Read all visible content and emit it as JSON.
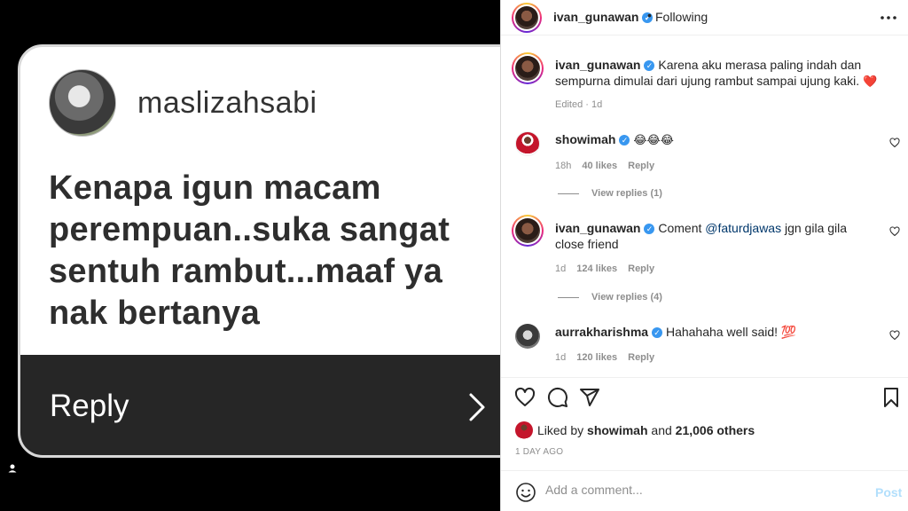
{
  "media": {
    "card_username": "maslizahsabi",
    "card_question": "Kenapa igun macam perempuan..suka sangat sentuh rambut...maaf ya nak bertanya",
    "reply_label": "Reply",
    "icons": [
      "chevron-right-icon",
      "tagged-user-icon"
    ]
  },
  "header": {
    "username": "ivan_gunawan",
    "separator": "•",
    "follow_status": "Following",
    "verified_mark": "✓"
  },
  "caption": {
    "username": "ivan_gunawan",
    "text": "Karena aku merasa paling indah dan sempurna dimulai dari ujung rambut sampai ujung kaki.",
    "emoji": "❤️",
    "meta": "Edited · 1d"
  },
  "comments": [
    {
      "username": "showimah",
      "text": "😂😂😂",
      "time": "18h",
      "likes": "40 likes",
      "reply_label": "Reply",
      "view_replies": "View replies (1)"
    },
    {
      "username": "ivan_gunawan",
      "text_prefix": "Coment ",
      "mention": "@faturdjawas",
      "text_suffix": " jgn gila gila close friend",
      "time": "1d",
      "likes": "124 likes",
      "reply_label": "Reply",
      "view_replies": "View replies (4)"
    },
    {
      "username": "aurrakharishma",
      "text": "Hahahaha well said! 💯",
      "time": "1d",
      "likes": "120 likes",
      "reply_label": "Reply"
    }
  ],
  "liked_by": {
    "prefix": "Liked by ",
    "user": "showimah",
    "middle": " and ",
    "others": "21,006 others"
  },
  "post_date": "1 DAY AGO",
  "comment_input": {
    "placeholder": "Add a comment...",
    "post_label": "Post"
  },
  "colors": {
    "verified": "#3897f0",
    "heart": "#ed4956",
    "mention": "#00376b",
    "post_disabled": "#b2dffc"
  }
}
